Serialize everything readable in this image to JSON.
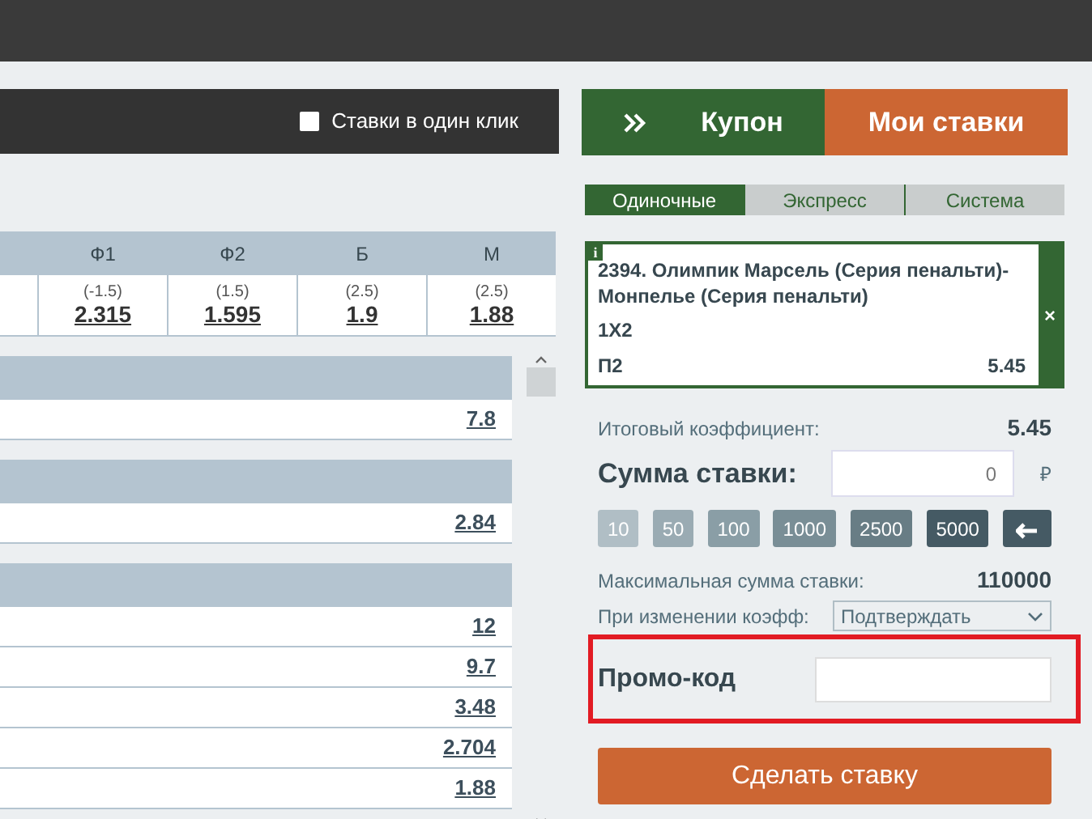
{
  "one_click": {
    "label": "Ставки в один клик",
    "checked": false
  },
  "odds_table": {
    "columns": [
      {
        "label": "Ф1",
        "param": "(-1.5)",
        "odds": "2.315"
      },
      {
        "label": "Ф2",
        "param": "(1.5)",
        "odds": "1.595"
      },
      {
        "label": "Б",
        "param": "(2.5)",
        "odds": "1.9"
      },
      {
        "label": "М",
        "param": "(2.5)",
        "odds": "1.88"
      }
    ]
  },
  "sections": [
    {
      "rows": [
        "7.8"
      ]
    },
    {
      "rows": [
        "2.84"
      ]
    },
    {
      "rows": [
        "12",
        "9.7",
        "3.48",
        "2.704",
        "1.88"
      ]
    }
  ],
  "coupon": {
    "tabs": [
      {
        "label": "Купон",
        "selected": true
      },
      {
        "label": "Мои ставки",
        "selected": false
      }
    ],
    "bet_types": [
      {
        "label": "Одиночные",
        "selected": true
      },
      {
        "label": "Экспресс",
        "selected": false
      },
      {
        "label": "Система",
        "selected": false
      }
    ],
    "bet": {
      "info_icon": "i",
      "close": "×",
      "event": "2394. Олимпик Марсель (Серия пенальти)-Монпелье (Серия пенальти)",
      "market": "1X2",
      "outcome": "П2",
      "odds": "5.45"
    },
    "total_odds": {
      "label": "Итоговый коэффициент:",
      "value": "5.45"
    },
    "stake": {
      "label": "Сумма ставки:",
      "value": "0",
      "currency": "₽"
    },
    "quick_amounts": [
      "10",
      "50",
      "100",
      "1000",
      "2500",
      "5000"
    ],
    "max_stake": {
      "label": "Максимальная сумма ставки:",
      "value": "110000"
    },
    "odds_change": {
      "label": "При изменении коэфф:",
      "value": "Подтверждать"
    },
    "promo": {
      "label": "Промо-код",
      "highlighted": true
    },
    "submit": "Сделать ставку"
  }
}
